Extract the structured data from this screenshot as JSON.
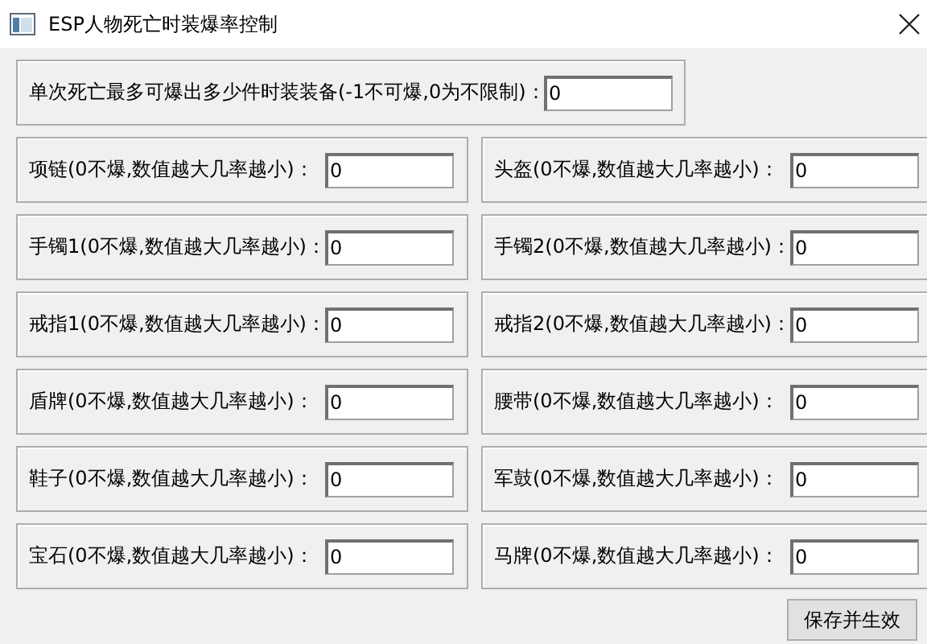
{
  "window": {
    "title": "ESP人物死亡时装爆率控制"
  },
  "limit": {
    "label": "单次死亡最多可爆出多少件时装装备(-1不可爆,0为不限制)：",
    "value": "0"
  },
  "slots": [
    {
      "label": "项链(0不爆,数值越大几率越小)：",
      "value": "0"
    },
    {
      "label": "头盔(0不爆,数值越大几率越小)：",
      "value": "0"
    },
    {
      "label": "手镯1(0不爆,数值越大几率越小)：",
      "value": "0"
    },
    {
      "label": "手镯2(0不爆,数值越大几率越小)：",
      "value": "0"
    },
    {
      "label": "戒指1(0不爆,数值越大几率越小)：",
      "value": "0"
    },
    {
      "label": "戒指2(0不爆,数值越大几率越小)：",
      "value": "0"
    },
    {
      "label": "盾牌(0不爆,数值越大几率越小)：",
      "value": "0"
    },
    {
      "label": "腰带(0不爆,数值越大几率越小)：",
      "value": "0"
    },
    {
      "label": "鞋子(0不爆,数值越大几率越小)：",
      "value": "0"
    },
    {
      "label": "军鼓(0不爆,数值越大几率越小)：",
      "value": "0"
    },
    {
      "label": "宝石(0不爆,数值越大几率越小)：",
      "value": "0"
    },
    {
      "label": "马牌(0不爆,数值越大几率越小)：",
      "value": "0"
    }
  ],
  "button": "保存并生效"
}
